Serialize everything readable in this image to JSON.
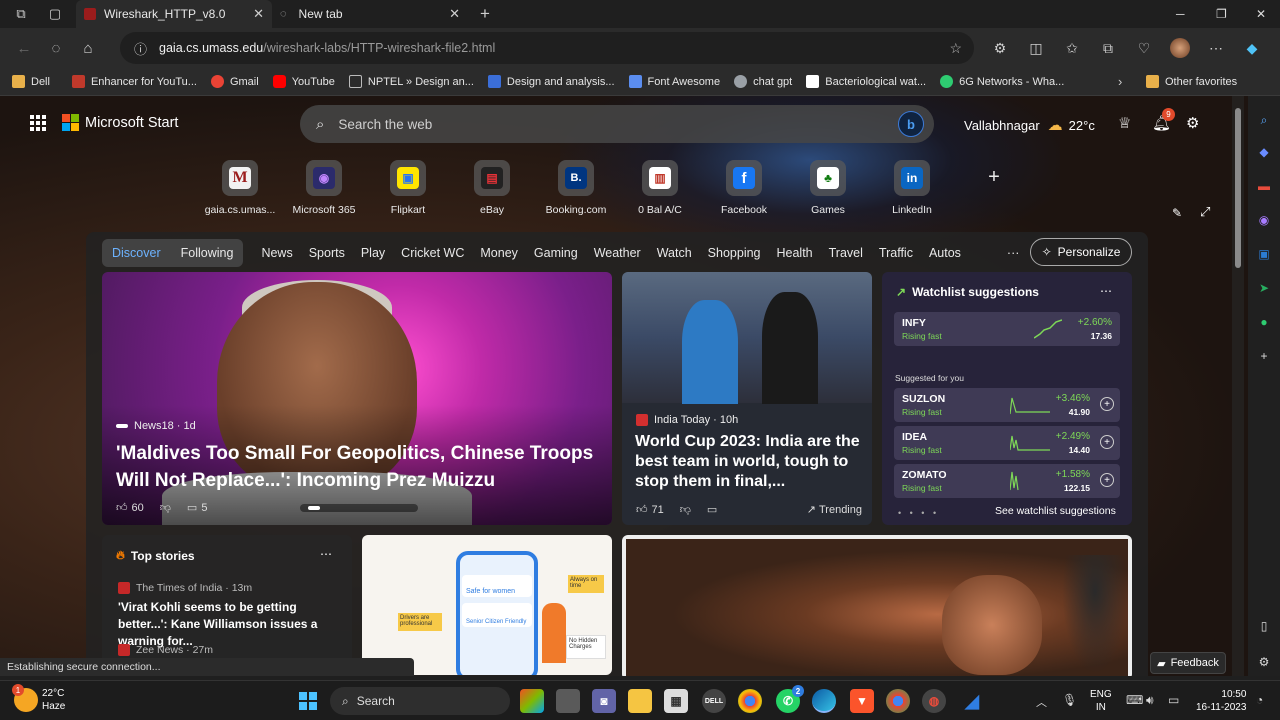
{
  "tabs": [
    {
      "title": "Wireshark_HTTP_v8.0"
    },
    {
      "title": "New tab"
    }
  ],
  "address": {
    "host": "gaia.cs.umass.edu",
    "path": "/wireshark-labs/HTTP-wireshark-file2.html"
  },
  "bookmarks": [
    {
      "label": "Dell",
      "color": "#e8b04a"
    },
    {
      "label": "Enhancer for YouTu...",
      "color": "#c0392b"
    },
    {
      "label": "Gmail",
      "color": "#ea4335"
    },
    {
      "label": "YouTube",
      "color": "#ff0000"
    },
    {
      "label": "NPTEL » Design an...",
      "color": "#bbbbbb"
    },
    {
      "label": "Design and analysis...",
      "color": "#3b6ed8"
    },
    {
      "label": "Font Awesome",
      "color": "#5b8def"
    },
    {
      "label": "chat gpt",
      "color": "#9aa0a6"
    },
    {
      "label": "Bacteriological wat...",
      "color": "#ffffff"
    },
    {
      "label": "6G Networks - Wha...",
      "color": "#2ecc71"
    }
  ],
  "other_favorites": "Other favorites",
  "ms": {
    "brand": "Microsoft Start",
    "search_placeholder": "Search the web",
    "location": "Vallabhnagar",
    "temp": "22°c",
    "notif_count": "9"
  },
  "quicklinks": [
    {
      "label": "gaia.cs.umas...",
      "glyph": "M",
      "bg": "#f2f2f2",
      "fg": "#9b1c1c"
    },
    {
      "label": "Microsoft 365",
      "glyph": "◉",
      "bg": "#2b2b6b",
      "fg": "#c084fc"
    },
    {
      "label": "Flipkart",
      "glyph": "▣",
      "bg": "#ffe500",
      "fg": "#2874f0"
    },
    {
      "label": "eBay",
      "glyph": "▤",
      "bg": "#222222",
      "fg": "#e53238"
    },
    {
      "label": "Booking.com",
      "glyph": "B.",
      "bg": "#003580",
      "fg": "#ffffff"
    },
    {
      "label": "0 Bal A/C",
      "glyph": "▥",
      "bg": "#ffffff",
      "fg": "#c0392b"
    },
    {
      "label": "Facebook",
      "glyph": "f",
      "bg": "#1877f2",
      "fg": "#ffffff"
    },
    {
      "label": "Games",
      "glyph": "♣",
      "bg": "#ffffff",
      "fg": "#107c10"
    },
    {
      "label": "LinkedIn",
      "glyph": "in",
      "bg": "#0a66c2",
      "fg": "#ffffff"
    }
  ],
  "categories": {
    "seg": [
      "Discover",
      "Following"
    ],
    "items": [
      "News",
      "Sports",
      "Play",
      "Cricket WC",
      "Money",
      "Gaming",
      "Weather",
      "Watch",
      "Shopping",
      "Health",
      "Travel",
      "Traffic",
      "Autos"
    ],
    "more": "···",
    "personalize": "Personalize"
  },
  "hero": {
    "source": "News18 · 1d",
    "title": "'Maldives Too Small For Geopolitics, Chinese Troops Will Not Replace...': Incoming Prez Muizzu",
    "likes": "60",
    "comments": "5"
  },
  "wc": {
    "source": "India Today · 10h",
    "title": "World Cup 2023: India are the best team in world, tough to stop them in final,...",
    "likes": "71",
    "trending": "Trending"
  },
  "watchlist": {
    "title": "Watchlist suggestions",
    "suggested": "Suggested for you",
    "see_more": "See watchlist suggestions",
    "rows": [
      {
        "sym": "INFY",
        "sub": "Rising fast",
        "pct": "+2.60%",
        "price": "17.36"
      },
      {
        "sym": "SUZLON",
        "sub": "Rising fast",
        "pct": "+3.46%",
        "price": "41.90"
      },
      {
        "sym": "IDEA",
        "sub": "Rising fast",
        "pct": "+2.49%",
        "price": "14.40"
      },
      {
        "sym": "ZOMATO",
        "sub": "Rising fast",
        "pct": "+1.58%",
        "price": "122.15"
      }
    ]
  },
  "topstories": {
    "title": "Top stories",
    "s1_source": "The Times of India · 13m",
    "s1_title": "'Virat Kohli seems to be getting better...': Kane Williamson issues a warning for...",
    "s2_source": "Zee News · 27m"
  },
  "ad": {
    "t1": "Safe for women",
    "t2": "Senior Citizen Friendly",
    "t3": "Always on time",
    "t4": "Drivers are professional",
    "t5": "No Hidden Charges"
  },
  "status": "Establishing secure connection...",
  "feedback": "Feedback",
  "taskbar": {
    "weather_temp": "22°C",
    "weather_desc": "Haze",
    "search": "Search",
    "lang1": "ENG",
    "lang2": "IN",
    "time": "10:50",
    "date": "16-11-2023",
    "weather_badge": "1",
    "chat_badge": "2"
  }
}
